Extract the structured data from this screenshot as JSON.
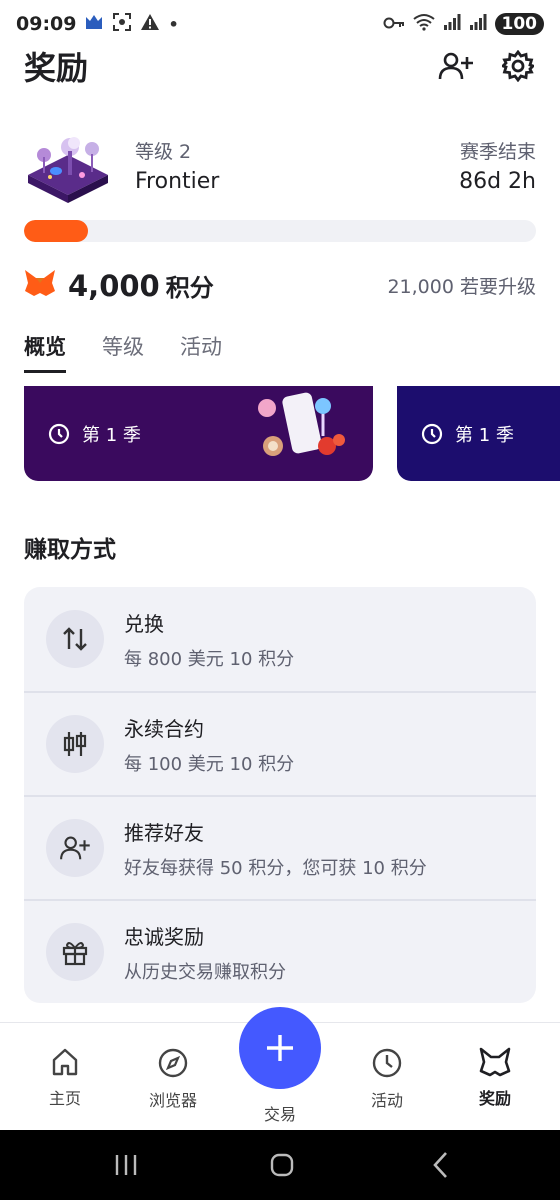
{
  "status_bar": {
    "time": "09:09",
    "battery": "100"
  },
  "header": {
    "title": "奖励"
  },
  "level": {
    "label": "等级 2",
    "name": "Frontier",
    "season_label": "赛季结束",
    "season_remaining": "86d 2h",
    "progress_fraction": 0.125
  },
  "points": {
    "value": "4,000",
    "unit": "积分",
    "next_level": "21,000 若要升级"
  },
  "tabs": [
    {
      "label": "概览",
      "active": true
    },
    {
      "label": "等级",
      "active": false
    },
    {
      "label": "活动",
      "active": false
    }
  ],
  "season_cards": [
    {
      "label": "第 1 季",
      "color": "#3a0a5e"
    },
    {
      "label": "第 1 季",
      "color": "#1c0d6e"
    }
  ],
  "earn": {
    "title": "赚取方式",
    "items": [
      {
        "name": "兑换",
        "desc": "每 800 美元 10 积分",
        "icon": "swap-icon"
      },
      {
        "name": "永续合约",
        "desc": "每 100 美元 10 积分",
        "icon": "candlestick-icon"
      },
      {
        "name": "推荐好友",
        "desc": "好友每获得 50 积分，您可获 10 积分",
        "icon": "add-user-icon"
      },
      {
        "name": "忠诚奖励",
        "desc": "从历史交易赚取积分",
        "icon": "gift-icon"
      }
    ]
  },
  "bottom_nav": {
    "home": "主页",
    "browser": "浏览器",
    "trade": "交易",
    "activity": "活动",
    "rewards": "奖励"
  },
  "colors": {
    "accent": "#4459ff",
    "progress": "#ff5c16"
  }
}
